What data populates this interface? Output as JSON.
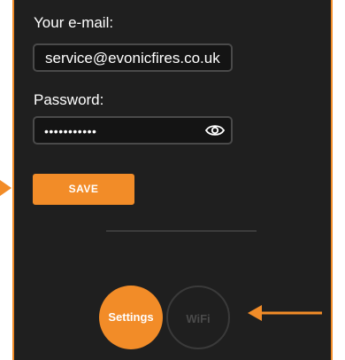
{
  "form": {
    "email_label": "Your e-mail:",
    "email_value": "service@evonicfires.co.uk",
    "password_label": "Password:",
    "password_mask": "•••••••••••",
    "save_label": "SAVE"
  },
  "tabs": {
    "settings_label": "Settings",
    "wifi_label": "WiFi"
  },
  "colors": {
    "accent": "#f28c28",
    "background": "#1f1f1f"
  },
  "icons": {
    "show_password": "eye-icon",
    "pointer": "arrow-left-icon",
    "edge_pointer": "arrow-right-icon"
  }
}
